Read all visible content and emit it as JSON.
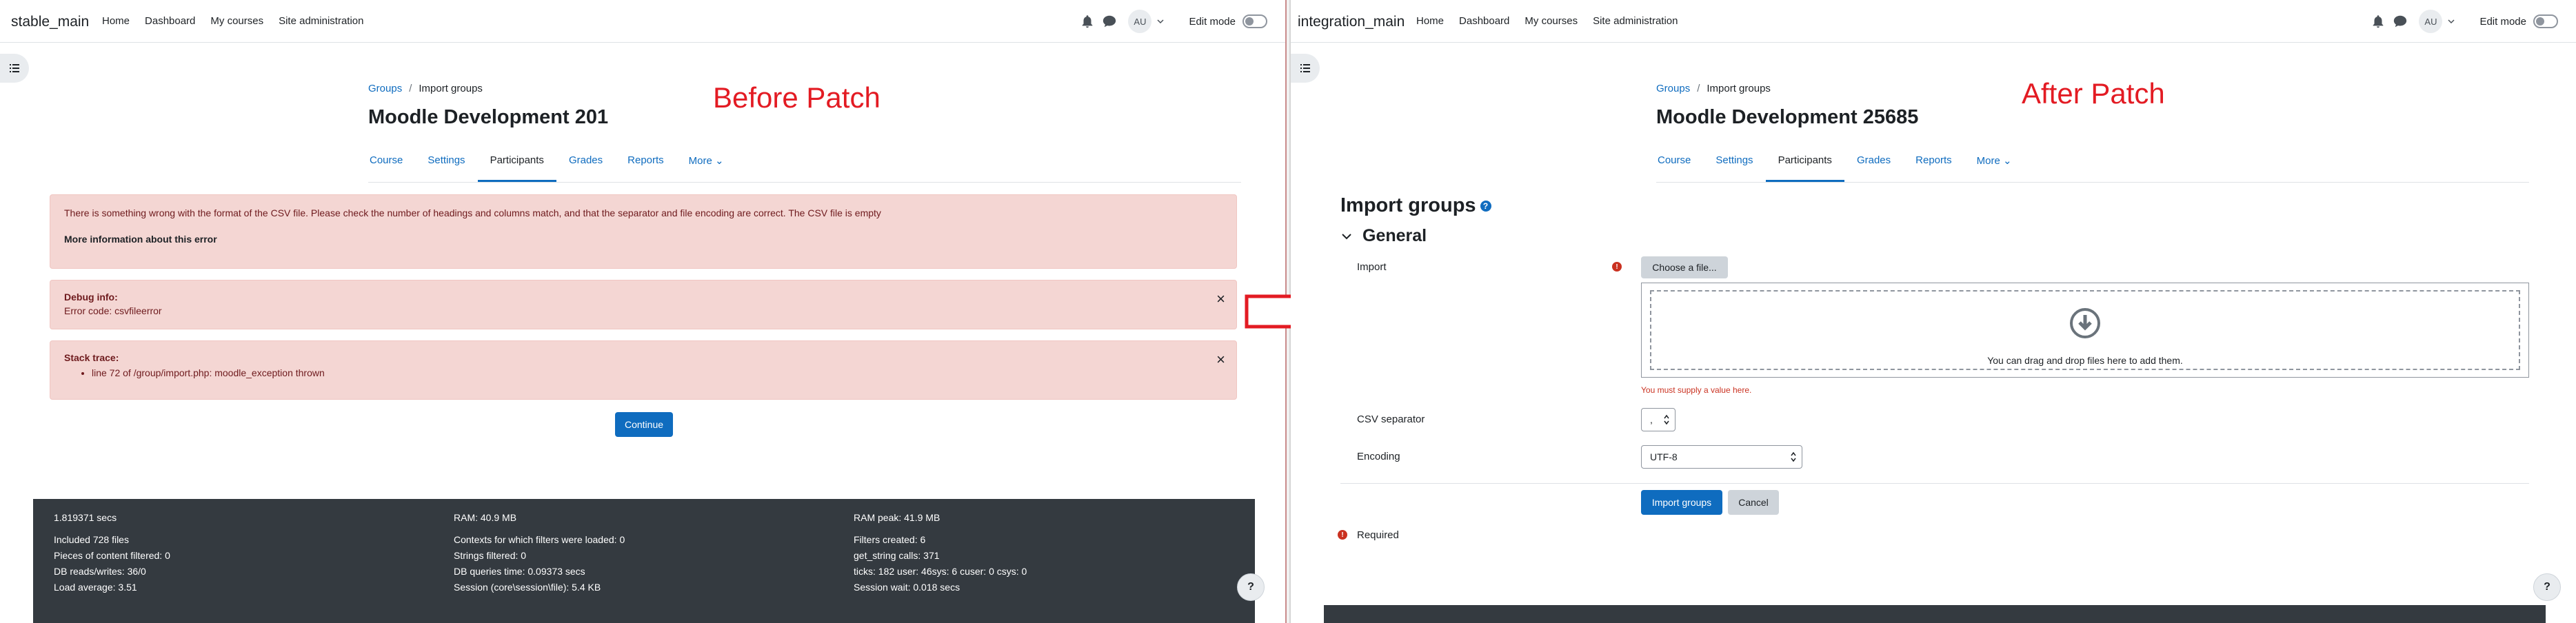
{
  "left": {
    "brand": "stable_main",
    "nav": [
      "Home",
      "Dashboard",
      "My courses",
      "Site administration"
    ],
    "user_initials": "AU",
    "edit_mode_label": "Edit mode",
    "breadcrumb": {
      "parent": "Groups",
      "sep": "/",
      "current": "Import groups"
    },
    "title": "Moodle Development 201",
    "tabs": [
      "Course",
      "Settings",
      "Participants",
      "Grades",
      "Reports",
      "More ⌄"
    ],
    "active_tab_index": 2,
    "patch_label": "Before Patch",
    "error_message": "There is something wrong with the format of the CSV file. Please check the number of headings and columns match, and that the separator and file encoding are correct. The CSV file is empty",
    "more_info": "More information about this error",
    "debug_title": "Debug info:",
    "debug_text": "Error code: csvfileerror",
    "stack_title": "Stack trace:",
    "stack_item": "line 72 of /group/import.php: moodle_exception thrown",
    "close_glyph": "×",
    "continue_label": "Continue",
    "footer": {
      "col1": [
        "1.819371 secs",
        "",
        "Included 728 files",
        "Pieces of content filtered: 0",
        "DB reads/writes: 36/0",
        "Load average: 3.51"
      ],
      "col2": [
        "RAM: 40.9 MB",
        "",
        "Contexts for which filters were loaded: 0",
        "Strings filtered: 0",
        "DB queries time: 0.09373 secs",
        "Session (core\\session\\file): 5.4 KB"
      ],
      "col3": [
        "RAM peak: 41.9 MB",
        "",
        "Filters created: 6",
        "get_string calls: 371",
        "ticks: 182 user: 46sys: 6 cuser: 0 csys: 0",
        "Session wait: 0.018 secs"
      ]
    },
    "help_label": "?"
  },
  "right": {
    "brand": "integration_main",
    "nav": [
      "Home",
      "Dashboard",
      "My courses",
      "Site administration"
    ],
    "user_initials": "AU",
    "edit_mode_label": "Edit mode",
    "breadcrumb": {
      "parent": "Groups",
      "sep": "/",
      "current": "Import groups"
    },
    "title": "Moodle Development 25685",
    "tabs": [
      "Course",
      "Settings",
      "Participants",
      "Grades",
      "Reports",
      "More ⌄"
    ],
    "active_tab_index": 2,
    "patch_label": "After Patch",
    "form_title": "Import groups",
    "help_glyph": "?",
    "section_title": "General",
    "import_label": "Import",
    "required_glyph": "!",
    "choose_file_label": "Choose a file...",
    "drop_text": "You can drag and drop files here to add them.",
    "field_error": "You must supply a value here.",
    "csv_separator_label": "CSV separator",
    "csv_separator_value": ",",
    "encoding_label": "Encoding",
    "encoding_value": "UTF-8",
    "import_button": "Import groups",
    "cancel_button": "Cancel",
    "required_note": "Required",
    "help_label": "?"
  },
  "colors": {
    "primary": "#0f6cbf",
    "danger": "#ca3120",
    "alert_bg": "#f4d6d3",
    "patch_label": "#e31b23",
    "footer_bg": "#343a40"
  }
}
